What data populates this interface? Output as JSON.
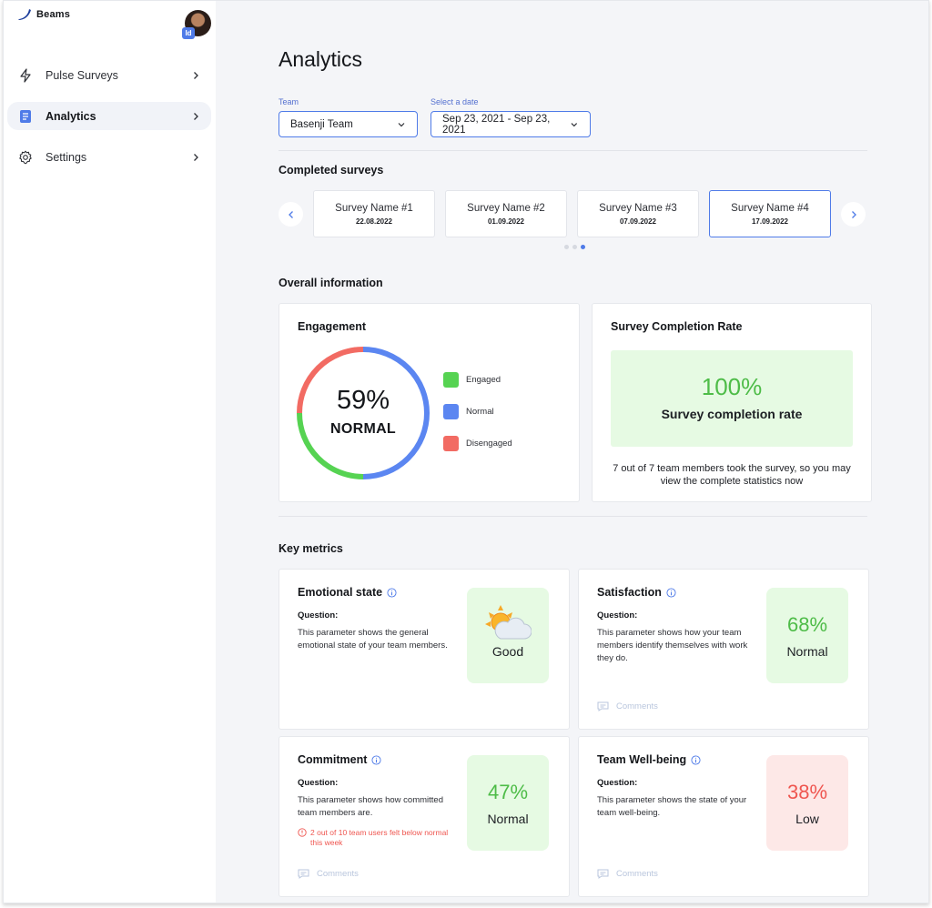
{
  "brand": {
    "name": "Beams"
  },
  "user": {
    "badge": "Id"
  },
  "sidebar": {
    "items": [
      {
        "label": "Pulse Surveys",
        "icon": "lightning-icon"
      },
      {
        "label": "Analytics",
        "icon": "clipboard-icon",
        "active": true
      },
      {
        "label": "Settings",
        "icon": "gear-icon"
      }
    ]
  },
  "page": {
    "title": "Analytics"
  },
  "filters": {
    "team_label": "Team",
    "team_value": "Basenji Team",
    "date_label": "Select a date",
    "date_value": "Sep 23, 2021 - Sep 23, 2021"
  },
  "completed": {
    "title": "Completed surveys",
    "surveys": [
      {
        "name": "Survey Name #1",
        "date": "22.08.2022"
      },
      {
        "name": "Survey Name #2",
        "date": "01.09.2022"
      },
      {
        "name": "Survey Name #3",
        "date": "07.09.2022"
      },
      {
        "name": "Survey Name #4",
        "date": "17.09.2022",
        "selected": true
      }
    ],
    "page_count": 3,
    "active_page": 3
  },
  "overall": {
    "title": "Overall information",
    "engagement": {
      "title": "Engagement",
      "value": "59%",
      "status": "NORMAL",
      "legend": [
        {
          "label": "Engaged",
          "color": "#56d352"
        },
        {
          "label": "Normal",
          "color": "#5b86f1"
        },
        {
          "label": "Disengaged",
          "color": "#f26b63"
        }
      ],
      "segments": {
        "normal": 0.5,
        "engaged": 0.25,
        "disengaged": 0.25
      }
    },
    "completion": {
      "title": "Survey Completion Rate",
      "value": "100%",
      "label": "Survey completion rate",
      "note": "7 out of 7 team members took the survey, so you may view the complete statistics now"
    }
  },
  "key_metrics": {
    "title": "Key metrics",
    "question_label": "Question:",
    "comments_label": "Comments",
    "emotional": {
      "title": "Emotional state",
      "question": "This parameter shows the general emotional state of your team members.",
      "status": "Good"
    },
    "satisfaction": {
      "title": "Satisfaction",
      "question": "This parameter shows how your team members identify themselves with work they do.",
      "value": "68%",
      "status": "Normal"
    },
    "commitment": {
      "title": "Commitment",
      "question": "This parameter shows how committed team members are.",
      "warning": "2 out of 10 team users felt below normal this week",
      "value": "47%",
      "status": "Normal"
    },
    "wellbeing": {
      "title": "Team Well-being",
      "question": "This parameter shows the state of your team well-being.",
      "value": "38%",
      "status": "Low"
    }
  },
  "colors": {
    "accent": "#4f7be8",
    "positive": "#4ebc48",
    "negative": "#ef5650"
  }
}
